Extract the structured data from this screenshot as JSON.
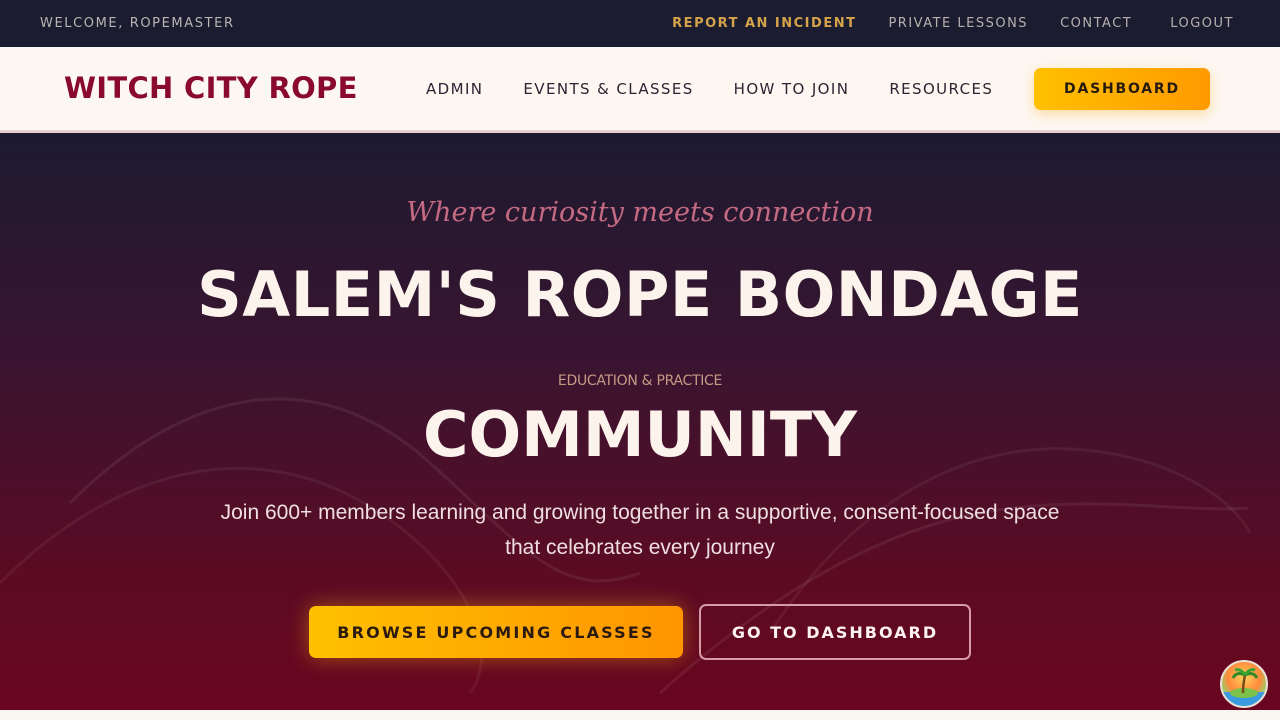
{
  "utility_bar": {
    "welcome": "WELCOME, ROPEMASTER",
    "links": {
      "report": "REPORT AN INCIDENT",
      "private": "PRIVATE LESSONS",
      "contact": "CONTACT",
      "logout": "LOGOUT"
    }
  },
  "header": {
    "brand": "WITCH CITY ROPE",
    "nav": {
      "admin": "ADMIN",
      "events": "EVENTS & CLASSES",
      "join": "HOW TO JOIN",
      "resources": "RESOURCES"
    },
    "dashboard_button": "DASHBOARD"
  },
  "hero": {
    "tagline": "Where curiosity meets connection",
    "headline_1": "SALEM'S ROPE BONDAGE",
    "kicker": "EDUCATION & PRACTICE",
    "headline_2": "COMMUNITY",
    "description": "Join 600+ members learning and growing together in a supportive, consent-focused space that celebrates every journey",
    "cta_primary": "BROWSE UPCOMING CLASSES",
    "cta_secondary": "GO TO DASHBOARD"
  },
  "colors": {
    "utility_bg": "#1c1c30",
    "brand": "#8a0a2e",
    "accent_gold": "#ffc000",
    "accent_orange": "#ff9a00",
    "hero_bottom": "#6a061f",
    "incident_link": "#d4a34a"
  },
  "icons": {
    "widget": "beach-sunset-icon"
  }
}
